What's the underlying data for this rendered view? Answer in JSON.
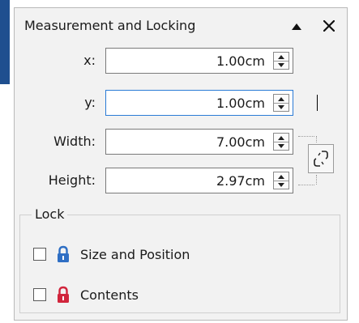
{
  "panel": {
    "title": "Measurement and Locking",
    "collapse_icon": "triangle-up-icon",
    "close_icon": "close-icon"
  },
  "fields": [
    {
      "label": "x:",
      "value": "1.00cm"
    },
    {
      "label": "y:",
      "value": "1.00cm",
      "focused": true
    },
    {
      "label": "Width:",
      "value": "7.00cm"
    },
    {
      "label": "Height:",
      "value": "2.97cm"
    }
  ],
  "keep_ratio_icon": "chain-link-icon",
  "lock_group": {
    "title": "Lock",
    "options": [
      {
        "label": "Size and Position",
        "checked": false,
        "icon": "blue-padlock-icon",
        "color": "#2f6fc4"
      },
      {
        "label": "Contents",
        "checked": false,
        "icon": "red-padlock-icon",
        "color": "#d1253c"
      }
    ]
  }
}
